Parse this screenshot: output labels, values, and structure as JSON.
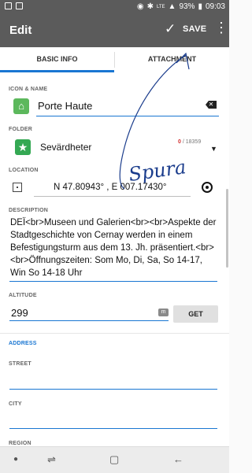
{
  "statusbar": {
    "battery": "93%",
    "time": "09:03",
    "signal_text": "LTE"
  },
  "appbar": {
    "title": "Edit",
    "save": "SAVE"
  },
  "tabs": {
    "basic": "BASIC INFO",
    "attachment": "ATTACHMENT"
  },
  "icon_name": {
    "label": "ICON & NAME",
    "value": "Porte Haute"
  },
  "folder": {
    "label": "FOLDER",
    "value": "Sevärdheter",
    "count_current": "0",
    "count_total": " / 18359"
  },
  "location": {
    "label": "LOCATION",
    "value": "N 47.80943° , E 007.17430°"
  },
  "description": {
    "label": "DESCRIPTION",
    "value": "DEÏ<br>Museen und Galerien<br><br>Aspekte der Stadtgeschichte von Cernay werden in einem Befestigungsturm aus dem 13. Jh. präsentiert.<br><br>Öffnungszeiten: Som Mo, Di, Sa, So 14-17,  Win So 14-18 Uhr"
  },
  "altitude": {
    "label": "ALTITUDE",
    "value": "299",
    "unit": "m",
    "button": "GET"
  },
  "address": {
    "label": "ADDRESS",
    "street": "STREET",
    "city": "CITY",
    "region": "REGION"
  },
  "handwriting": "Spura",
  "colors": {
    "accent": "#1976d2",
    "appbar": "#5b5b5b",
    "icon_green": "#5cb85c",
    "ink": "#1a3c8c"
  }
}
